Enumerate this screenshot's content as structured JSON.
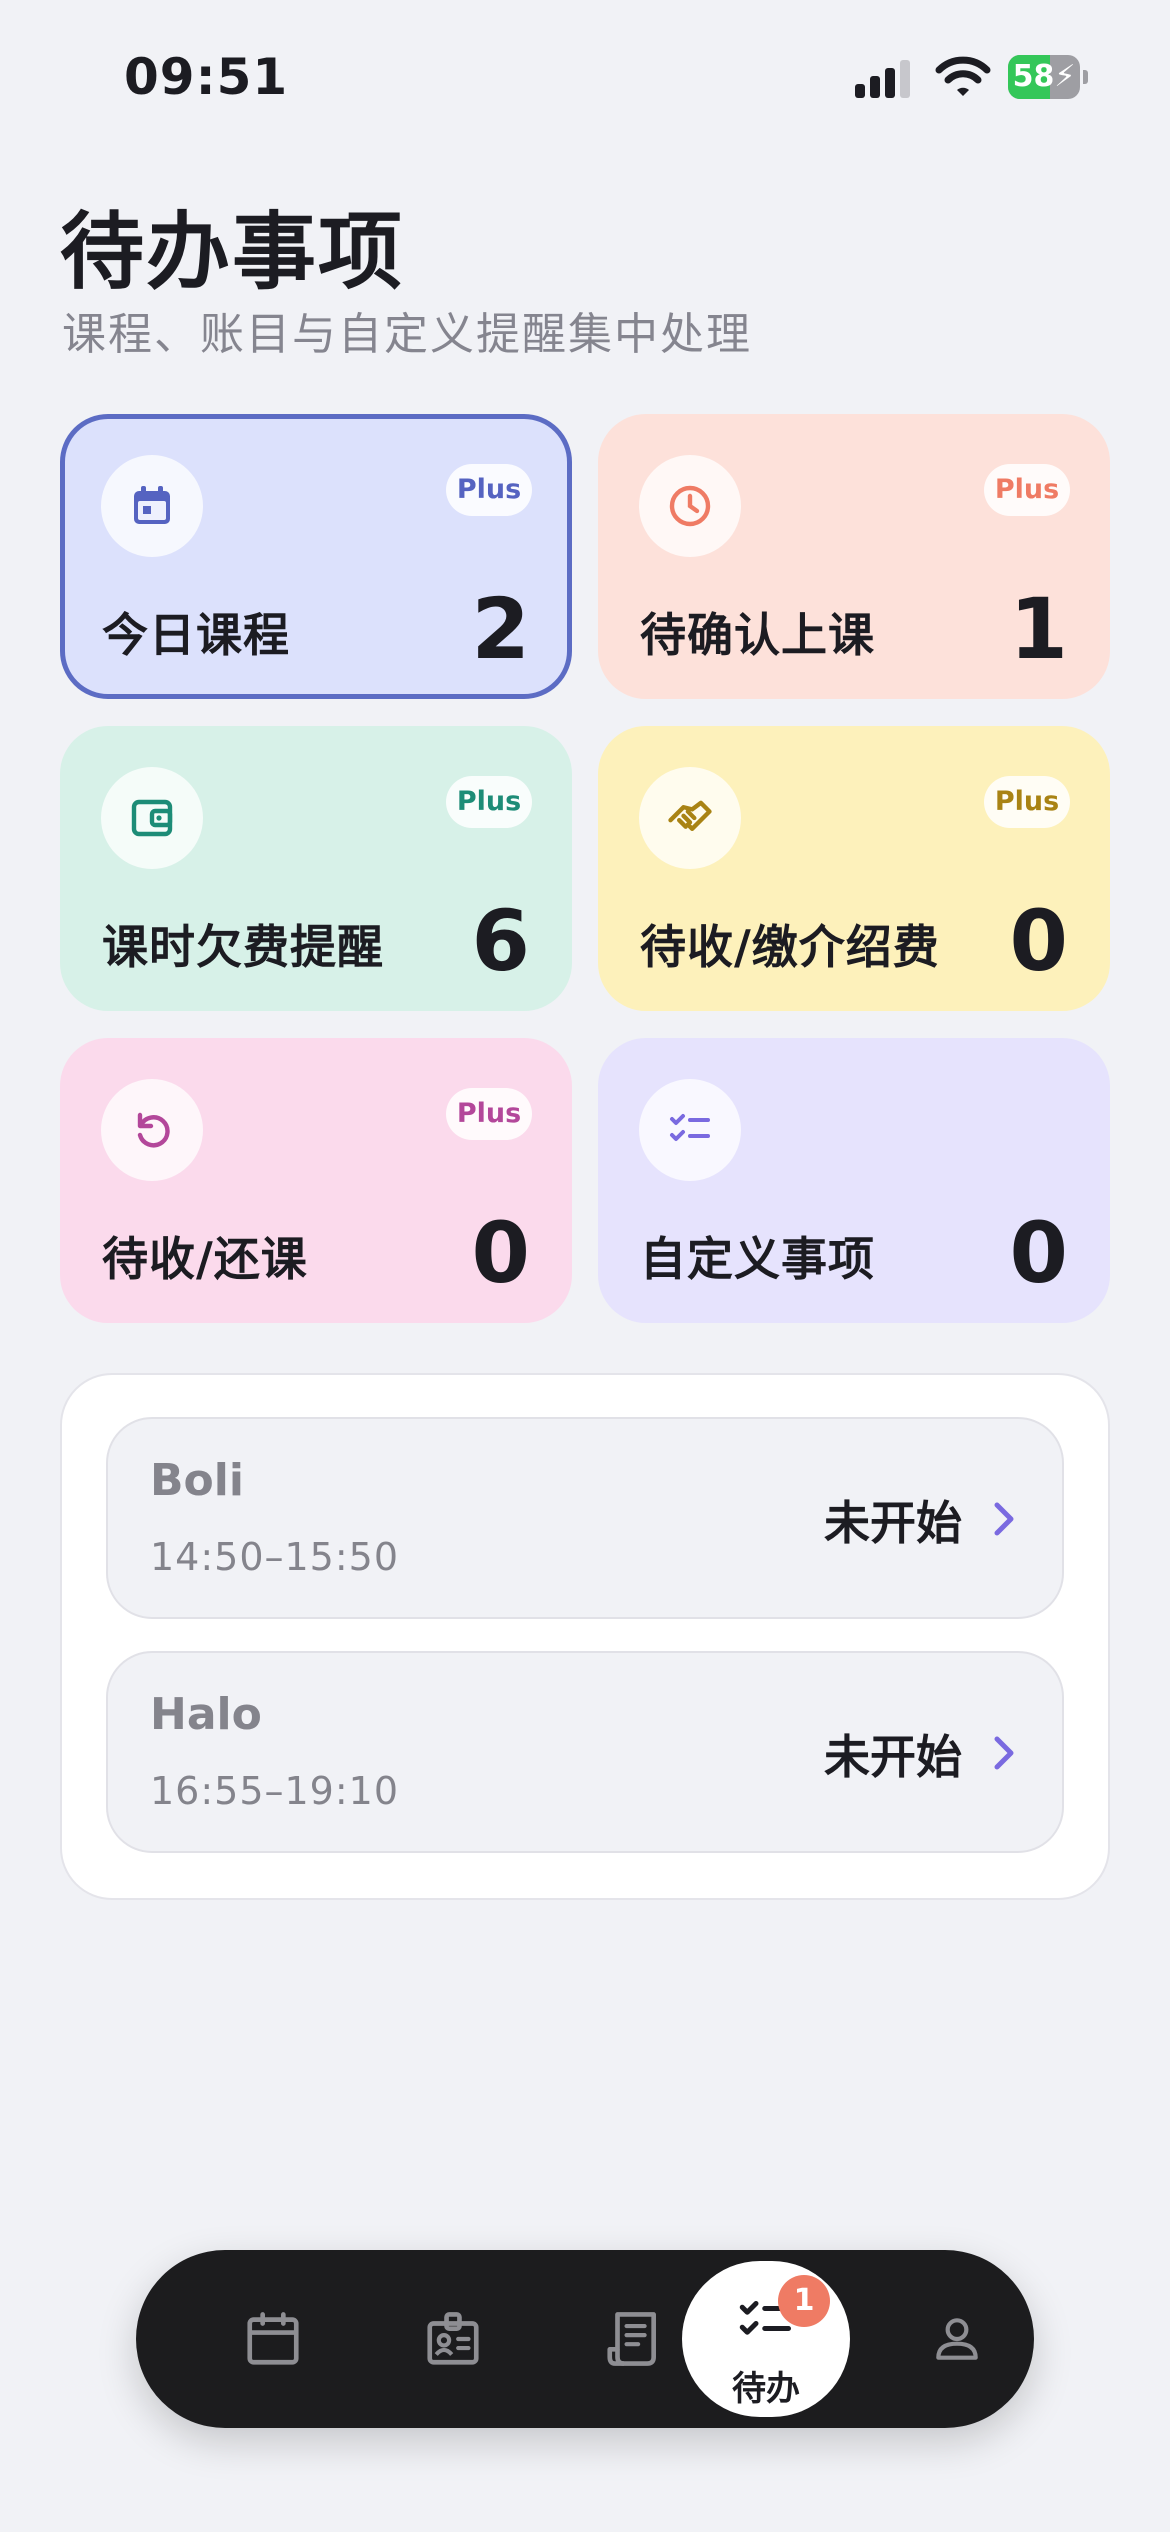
{
  "status_bar": {
    "time": "09:51",
    "battery": "58",
    "battery_level": 0.58,
    "icons": [
      "signal-icon",
      "wifi-icon",
      "battery-charging-icon"
    ]
  },
  "header": {
    "title": "待办事项",
    "subtitle": "课程、账目与自定义提醒集中处理"
  },
  "cards": [
    {
      "label": "今日课程",
      "count": "2",
      "plus": "Plus",
      "icon": "calendar-icon",
      "bg": "#dce1fc",
      "accent": "#5563c1"
    },
    {
      "label": "待确认上课",
      "count": "1",
      "plus": "Plus",
      "icon": "clock-icon",
      "bg": "#fde1da",
      "accent": "#ef7b64"
    },
    {
      "label": "课时欠费提醒",
      "count": "6",
      "plus": "Plus",
      "icon": "wallet-icon",
      "bg": "#d7f1e8",
      "accent": "#1d8c77"
    },
    {
      "label": "待收/缴介绍费",
      "count": "0",
      "plus": "Plus",
      "icon": "handshake-icon",
      "bg": "#fdf1bb",
      "accent": "#a98314"
    },
    {
      "label": "待收/还课",
      "count": "0",
      "plus": "Plus",
      "icon": "undo-icon",
      "bg": "#fbdaec",
      "accent": "#b3479a"
    },
    {
      "label": "自定义事项",
      "count": "0",
      "plus": "",
      "icon": "checklist-icon",
      "bg": "#e6e3fd",
      "accent": "#7a6ae0"
    }
  ],
  "classes": [
    {
      "name": "Boli",
      "time": "14:50–15:50",
      "status": "未开始"
    },
    {
      "name": "Halo",
      "time": "16:55–19:10",
      "status": "未开始"
    }
  ],
  "tabbar": {
    "tabs": [
      {
        "icon": "calendar-icon"
      },
      {
        "icon": "id-card-icon"
      },
      {
        "icon": "receipt-icon"
      },
      {
        "icon": "checklist-icon",
        "label": "待办",
        "badge": "1",
        "active": true
      },
      {
        "icon": "person-icon"
      }
    ]
  }
}
